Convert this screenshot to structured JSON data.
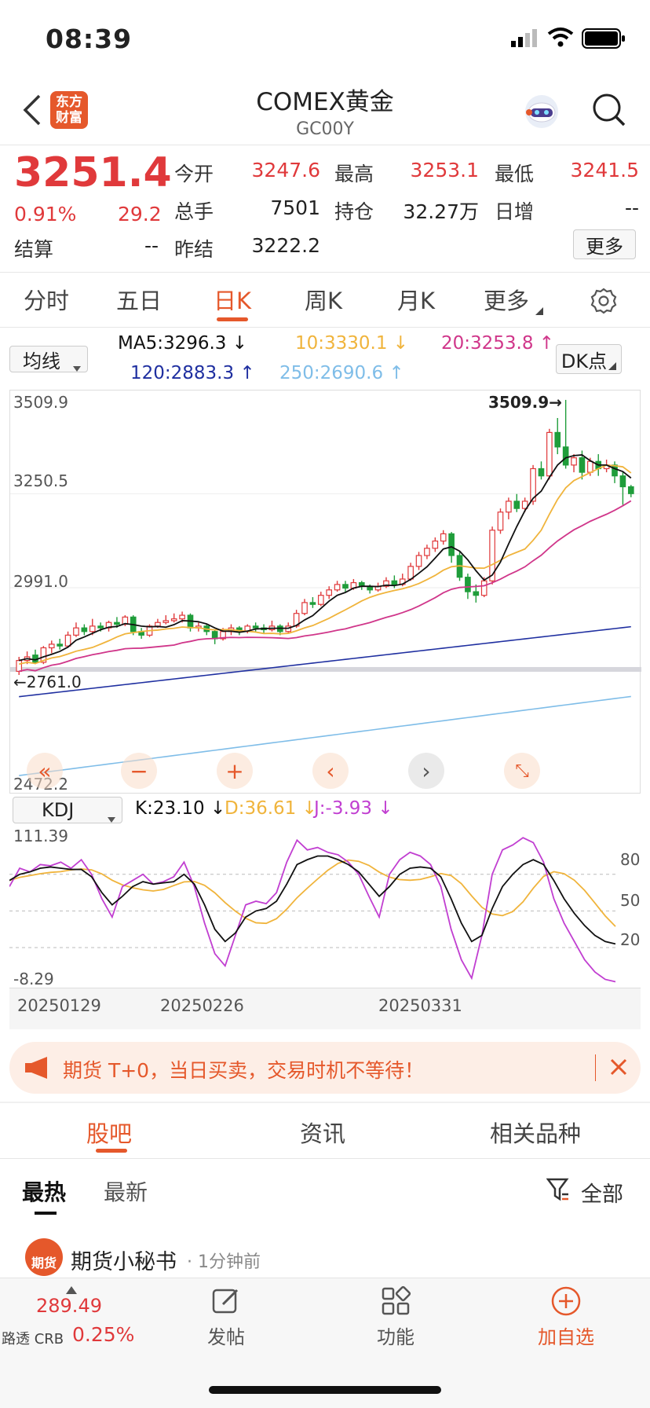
{
  "status": {
    "time": "08:39"
  },
  "header": {
    "title": "COMEX黄金",
    "code": "GC00Y",
    "logo_text": [
      "东方",
      "财富"
    ]
  },
  "quote": {
    "price": "3251.4",
    "change_pct": "0.91%",
    "change": "29.2",
    "open_label": "今开",
    "open": "3247.6",
    "high_label": "最高",
    "high": "3253.1",
    "low_label": "最低",
    "low": "3241.5",
    "volume_label": "总手",
    "volume": "7501",
    "oi_label": "持仓",
    "oi": "32.27万",
    "daily_add_label": "日增",
    "daily_add": "--",
    "settle_label": "结算",
    "settle": "--",
    "prev_settle_label": "昨结",
    "prev_settle": "3222.2",
    "more_label": "更多"
  },
  "period_tabs": [
    {
      "label": "分时"
    },
    {
      "label": "五日"
    },
    {
      "label": "日K"
    },
    {
      "label": "周K"
    },
    {
      "label": "月K"
    },
    {
      "label": "更多"
    }
  ],
  "indicator": {
    "selector_label": "均线",
    "ma5": "MA5:3296.3",
    "ma10": "10:3330.1",
    "ma20": "20:3253.8",
    "ma120": "120:2883.3",
    "ma250": "250:2690.6",
    "dk_label": "DK点"
  },
  "colors": {
    "red": "#e0393b",
    "green": "#1f9d3a",
    "ma5": "#111111",
    "ma10": "#f0b43c",
    "ma20": "#d0368a",
    "ma120": "#1f2fa0",
    "ma250": "#7fbde8",
    "accent": "#e5582b"
  },
  "chart_axes": {
    "y_top": "3509.9",
    "y_mid1": "3250.5",
    "y_mid2": "2991.0",
    "y_low_marker": "2761.0",
    "y_bottom": "2472.2",
    "high_marker": "3509.9"
  },
  "kdj": {
    "selector_label": "KDJ",
    "k": "K:23.10",
    "d": "D:36.61",
    "j": "J:-3.93",
    "y_top": "111.39",
    "y_bottom": "-8.29",
    "levels": [
      "80",
      "50",
      "20"
    ]
  },
  "dates": [
    "20250129",
    "20250226",
    "20250331"
  ],
  "banner": {
    "text": "期货 T+0，当日买卖，交易时机不等待！"
  },
  "content_tabs": [
    {
      "label": "股吧"
    },
    {
      "label": "资讯"
    },
    {
      "label": "相关品种"
    }
  ],
  "sub_tabs": [
    {
      "label": "最热"
    },
    {
      "label": "最新"
    }
  ],
  "filter_label": "全部",
  "post": {
    "author": "期货小秘书",
    "time": "1分钟前",
    "avatar_text": "期货"
  },
  "bottom_bar": {
    "crb_value": "289.49",
    "crb_label": "路透 CRB",
    "crb_pct": "0.25%",
    "post_label": "发帖",
    "func_label": "功能",
    "watch_label": "加自选"
  },
  "chart_data": {
    "type": "candlestick",
    "series": [
      {
        "name": "MA5",
        "value": "3296.3"
      },
      {
        "name": "10",
        "value": "3330.1"
      },
      {
        "name": "20",
        "value": "3253.8"
      },
      {
        "name": "120",
        "value": "2883.3"
      },
      {
        "name": "250",
        "value": "2690.6"
      }
    ],
    "ylim": [
      2472.2,
      3509.9
    ],
    "yticks": [
      3509.9,
      3250.5,
      2991.0,
      2472.2
    ],
    "candles": [
      [
        2760,
        2790,
        2750,
        2800
      ],
      [
        2790,
        2800,
        2780,
        2815
      ],
      [
        2805,
        2785,
        2780,
        2820
      ],
      [
        2785,
        2825,
        2780,
        2830
      ],
      [
        2825,
        2835,
        2810,
        2845
      ],
      [
        2835,
        2830,
        2820,
        2850
      ],
      [
        2830,
        2860,
        2825,
        2870
      ],
      [
        2860,
        2880,
        2855,
        2895
      ],
      [
        2880,
        2870,
        2860,
        2890
      ],
      [
        2870,
        2885,
        2860,
        2905
      ],
      [
        2885,
        2880,
        2870,
        2895
      ],
      [
        2880,
        2895,
        2870,
        2900
      ],
      [
        2895,
        2890,
        2880,
        2910
      ],
      [
        2890,
        2910,
        2885,
        2915
      ],
      [
        2910,
        2870,
        2860,
        2915
      ],
      [
        2870,
        2860,
        2850,
        2880
      ],
      [
        2860,
        2885,
        2855,
        2890
      ],
      [
        2885,
        2895,
        2880,
        2905
      ],
      [
        2895,
        2900,
        2890,
        2915
      ],
      [
        2900,
        2905,
        2895,
        2920
      ],
      [
        2905,
        2915,
        2895,
        2925
      ],
      [
        2915,
        2880,
        2870,
        2920
      ],
      [
        2880,
        2885,
        2870,
        2895
      ],
      [
        2885,
        2870,
        2860,
        2890
      ],
      [
        2870,
        2850,
        2835,
        2875
      ],
      [
        2850,
        2870,
        2845,
        2880
      ],
      [
        2870,
        2880,
        2860,
        2890
      ],
      [
        2880,
        2870,
        2860,
        2885
      ],
      [
        2870,
        2885,
        2865,
        2890
      ],
      [
        2885,
        2880,
        2870,
        2895
      ],
      [
        2880,
        2875,
        2865,
        2890
      ],
      [
        2875,
        2885,
        2870,
        2900
      ],
      [
        2885,
        2870,
        2860,
        2890
      ],
      [
        2870,
        2885,
        2865,
        2895
      ],
      [
        2885,
        2920,
        2880,
        2930
      ],
      [
        2920,
        2950,
        2915,
        2960
      ],
      [
        2950,
        2945,
        2935,
        2965
      ],
      [
        2945,
        2970,
        2940,
        2980
      ],
      [
        2970,
        2985,
        2960,
        2995
      ],
      [
        2985,
        3000,
        2980,
        3010
      ],
      [
        3000,
        2990,
        2980,
        3010
      ],
      [
        2990,
        3005,
        2985,
        3015
      ],
      [
        3005,
        2995,
        2985,
        3010
      ],
      [
        2995,
        2985,
        2975,
        3000
      ],
      [
        2985,
        2995,
        2980,
        3005
      ],
      [
        2995,
        3010,
        2990,
        3020
      ],
      [
        3010,
        3000,
        2990,
        3025
      ],
      [
        3000,
        3015,
        2995,
        3030
      ],
      [
        3015,
        3050,
        3010,
        3060
      ],
      [
        3050,
        3080,
        3040,
        3090
      ],
      [
        3080,
        3100,
        3070,
        3110
      ],
      [
        3100,
        3120,
        3090,
        3130
      ],
      [
        3120,
        3140,
        3110,
        3150
      ],
      [
        3140,
        3080,
        3060,
        3145
      ],
      [
        3080,
        3020,
        3010,
        3090
      ],
      [
        3020,
        2980,
        2960,
        3030
      ],
      [
        2980,
        2970,
        2950,
        3000
      ],
      [
        2970,
        3010,
        2965,
        3020
      ],
      [
        3010,
        3150,
        3000,
        3160
      ],
      [
        3150,
        3200,
        3140,
        3210
      ],
      [
        3200,
        3230,
        3180,
        3240
      ],
      [
        3230,
        3210,
        3200,
        3250
      ],
      [
        3210,
        3230,
        3200,
        3240
      ],
      [
        3230,
        3320,
        3220,
        3330
      ],
      [
        3320,
        3300,
        3290,
        3340
      ],
      [
        3300,
        3420,
        3290,
        3430
      ],
      [
        3420,
        3380,
        3360,
        3460
      ],
      [
        3380,
        3330,
        3320,
        3510
      ],
      [
        3330,
        3350,
        3310,
        3360
      ],
      [
        3350,
        3310,
        3290,
        3370
      ],
      [
        3310,
        3340,
        3300,
        3350
      ],
      [
        3340,
        3320,
        3300,
        3360
      ],
      [
        3320,
        3330,
        3310,
        3345
      ],
      [
        3330,
        3300,
        3280,
        3340
      ],
      [
        3300,
        3270,
        3220,
        3310
      ],
      [
        3270,
        3251,
        3241,
        3275
      ]
    ]
  }
}
